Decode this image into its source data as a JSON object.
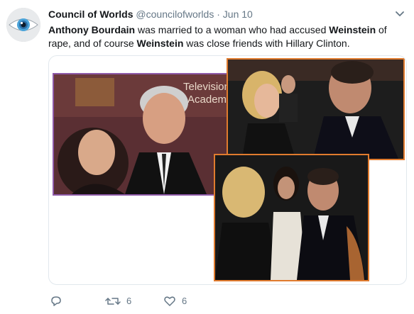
{
  "tweet": {
    "display_name": "Council of Worlds",
    "handle": "@councilofworlds",
    "separator": "·",
    "timestamp": "Jun 10",
    "text_parts": {
      "p1": "Anthony Bourdain",
      "p2": " was married to a woman who had accused ",
      "p3": "Weinstein",
      "p4": " of rape, and of course ",
      "p5": "Weinstein",
      "p6": " was close friends with Hillary Clinton."
    },
    "photo_text": {
      "top_left_sign_1": "Television",
      "top_left_sign_2": "Academy"
    }
  },
  "actions": {
    "reply_count": "",
    "retweet_count": "6",
    "like_count": "6"
  },
  "colors": {
    "purple_frame": "#8e5aa8",
    "orange_frame": "#e07b2e",
    "muted_text": "#657786"
  }
}
